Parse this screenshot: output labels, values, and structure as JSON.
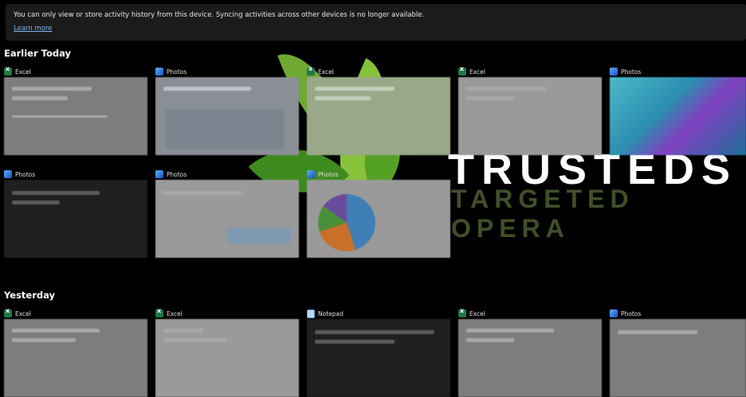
{
  "banner": {
    "message": "You can only view or store activity history from this device. Syncing activities across other devices is no longer available.",
    "link": "Learn more"
  },
  "sections": [
    {
      "title": "Earlier Today",
      "cards": [
        {
          "app": "Excel",
          "icon": "excel-icon"
        },
        {
          "app": "Photos",
          "icon": "photos-icon"
        },
        {
          "app": "Excel",
          "icon": "excel-icon"
        },
        {
          "app": "Excel",
          "icon": "excel-icon"
        },
        {
          "app": "Photos",
          "icon": "photos-icon"
        },
        {
          "app": "Photos",
          "icon": "photos-icon"
        },
        {
          "app": "Photos",
          "icon": "photos-icon"
        },
        {
          "app": "Photos",
          "icon": "photos-icon"
        }
      ]
    },
    {
      "title": "Yesterday",
      "cards": [
        {
          "app": "Excel",
          "icon": "excel-icon"
        },
        {
          "app": "Excel",
          "icon": "excel-icon"
        },
        {
          "app": "Notepad",
          "icon": "notepad-icon"
        },
        {
          "app": "Excel",
          "icon": "excel-icon"
        },
        {
          "app": "Photos",
          "icon": "photos-icon"
        }
      ]
    }
  ],
  "wallpaper": {
    "brand_line1": "TRUSTEDS",
    "brand_line2": "TARGETED OPERA"
  },
  "colors": {
    "background": "#000000",
    "banner": "#1b1b1b",
    "link": "#7fb6f0",
    "excel": "#1d7a43",
    "brand_green": "#3f4f2a"
  }
}
